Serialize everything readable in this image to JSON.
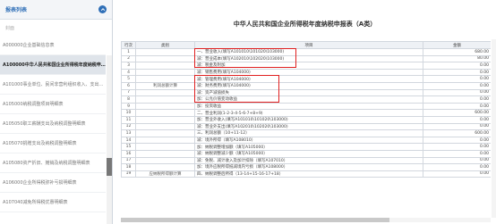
{
  "sidebar": {
    "title": "报表列表",
    "search_placeholder": "封面",
    "items": [
      {
        "label": "A000000企业基础信息表"
      },
      {
        "label": "A100000中华人民共和国企业所得税年度纳税申..."
      },
      {
        "label": "A101000事业单位、民间非营利组织收入、支出明细表"
      },
      {
        "label": "A105000纳税调整项目明细表"
      },
      {
        "label": "A105050职工薪酬支出及纳税调整明细表"
      },
      {
        "label": "A105070捐赠支出及纳税调整明细表"
      },
      {
        "label": "A105080资产折旧、摊销及纳税调整明细表"
      },
      {
        "label": "A106000企业所得税弥补亏损明细表"
      },
      {
        "label": "A107040减免所得税优惠明细表"
      }
    ]
  },
  "main": {
    "title": "中华人民共和国企业所得税年度纳税申报表（A类）",
    "headers": {
      "row_no": "行次",
      "category": "类别",
      "item": "项目",
      "amount": "金额"
    },
    "rows": [
      {
        "no": "1",
        "cat": "",
        "item": "一、营业收入(填写A101010\\101020\\103000)",
        "amt": "680.00"
      },
      {
        "no": "2",
        "cat": "",
        "item": "减：营业成本(填写A102010\\102020\\103000)",
        "amt": "80.00"
      },
      {
        "no": "3",
        "cat": "",
        "item": "减：税金及附加",
        "amt": "0.00"
      },
      {
        "no": "4",
        "cat": "",
        "item": "减：销售费用(填写A104000)",
        "amt": "0.00"
      },
      {
        "no": "5",
        "cat": "",
        "item": "减：管理费用(填写A104000)",
        "amt": "0.00"
      },
      {
        "no": "6",
        "cat": "利润总额计算",
        "item": "减：财务费用(填写A104000)",
        "amt": "0.00"
      },
      {
        "no": "7",
        "cat": "",
        "item": "减：资产减值损失",
        "amt": "0.00"
      },
      {
        "no": "8",
        "cat": "",
        "item": "加：公允价值变动收益",
        "amt": "0.00"
      },
      {
        "no": "9",
        "cat": "",
        "item": "加：投资收益",
        "amt": "0.00"
      },
      {
        "no": "10",
        "cat": "",
        "item": "二、营业利润(1-2-3-4-5-6-7+8+9)",
        "amt": "600.00"
      },
      {
        "no": "11",
        "cat": "",
        "item": "加：营业外收入(填写A101010\\101020\\103000)",
        "amt": "0.00"
      },
      {
        "no": "12",
        "cat": "",
        "item": "减：营业外支出(填写A102010\\102020\\103000)",
        "amt": "0.00"
      },
      {
        "no": "13",
        "cat": "",
        "item": "三、利润总额（10+11-12）",
        "amt": "600.00"
      },
      {
        "no": "14",
        "cat": "",
        "item": "减：境外所得（填写A108010）",
        "amt": "0.00"
      },
      {
        "no": "15",
        "cat": "",
        "item": "加：纳税调整增加额（填写A105000）",
        "amt": "0.00"
      },
      {
        "no": "16",
        "cat": "",
        "item": "减：纳税调整减少额（填写A105000）",
        "amt": "0.00"
      },
      {
        "no": "17",
        "cat": "",
        "item": "减：免税、减计收入及加计扣除（填写A107010）",
        "amt": "0.00"
      },
      {
        "no": "18",
        "cat": "",
        "item": "加：境外应税所得抵减境内亏损（填写A108000）",
        "amt": "0.00"
      },
      {
        "no": "19",
        "cat": "应纳税所得额计算",
        "item": "四、纳税调整后所得（13-14+15-16-17+18）",
        "amt": "0.00"
      }
    ]
  },
  "colors": {
    "accent": "#2f6fb7",
    "highlight": "#e02020"
  }
}
